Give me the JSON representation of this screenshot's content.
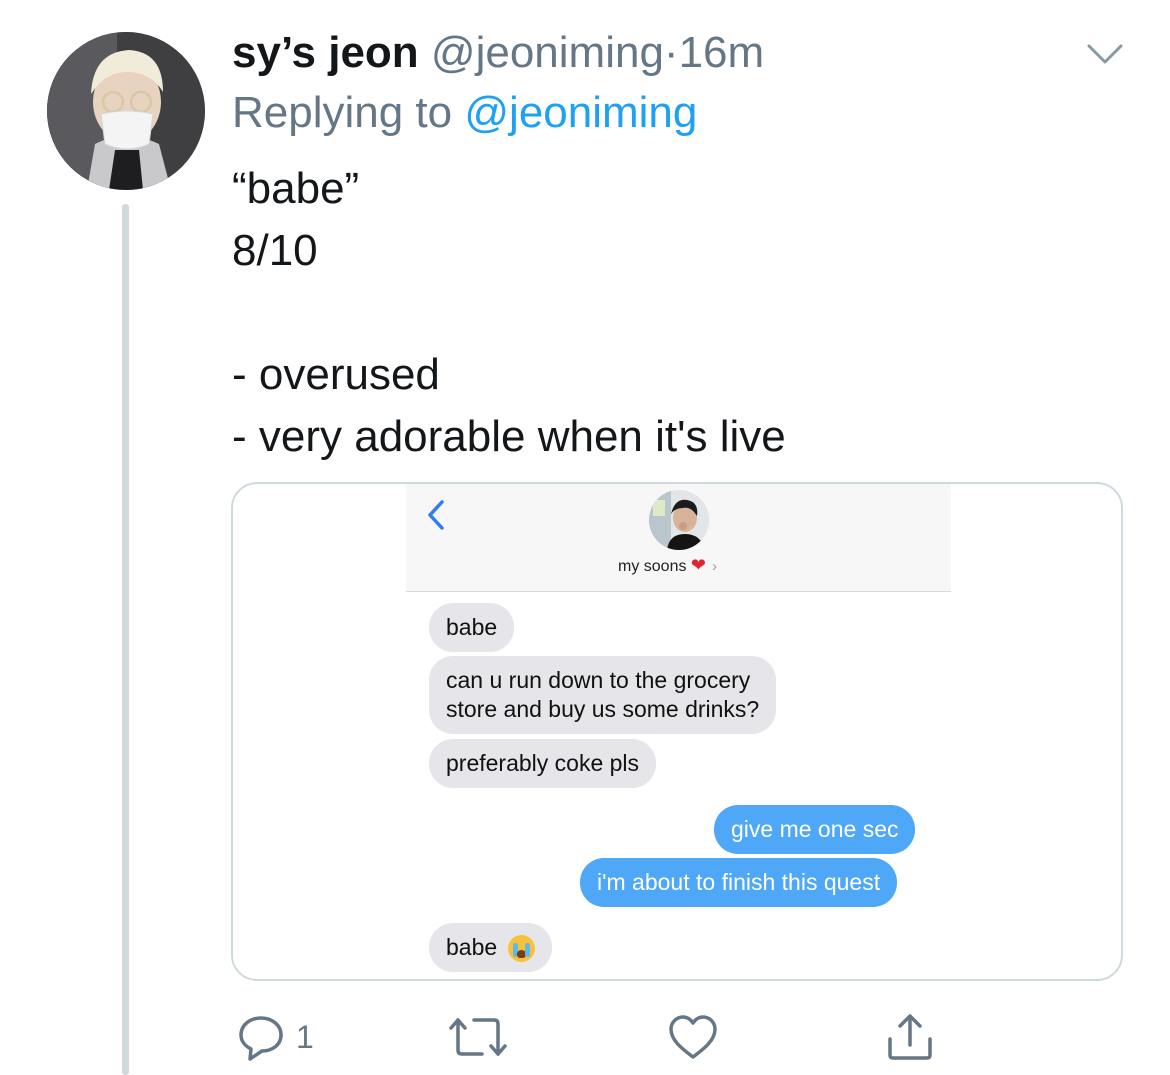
{
  "tweet": {
    "display_name": "sy’s jeon",
    "handle": "@jeoniming",
    "separator": "·",
    "time": "16m",
    "replying_prefix": "Replying to",
    "replying_to": "@jeoniming",
    "text_lines": [
      "“babe”",
      "8/10",
      "",
      "- overused",
      "- very adorable when it's live"
    ]
  },
  "media": {
    "contact_name": "my soons",
    "messages": [
      {
        "side": "in",
        "lines": [
          "babe"
        ]
      },
      {
        "side": "in",
        "lines": [
          "can u run down to the grocery",
          "store and buy us some drinks?"
        ]
      },
      {
        "side": "in",
        "lines": [
          "preferably coke pls"
        ]
      },
      {
        "side": "out",
        "lines": [
          "give me one sec"
        ]
      },
      {
        "side": "out",
        "lines": [
          "i'm about to finish this quest"
        ]
      },
      {
        "side": "in",
        "lines": [
          "babe"
        ]
      }
    ]
  },
  "actions": {
    "reply_count": "1",
    "retweet_count": "",
    "like_count": ""
  },
  "icons": {
    "menu": "chevron-down-icon",
    "reply": "speech-bubble-icon",
    "retweet": "retweet-arrows-icon",
    "like": "heart-icon",
    "share": "share-upload-icon"
  },
  "colors": {
    "link": "#1da1f2",
    "secondary_text": "#657786",
    "incoming_bubble": "#e5e5ea",
    "outgoing_bubble": "#4fa8f7"
  }
}
